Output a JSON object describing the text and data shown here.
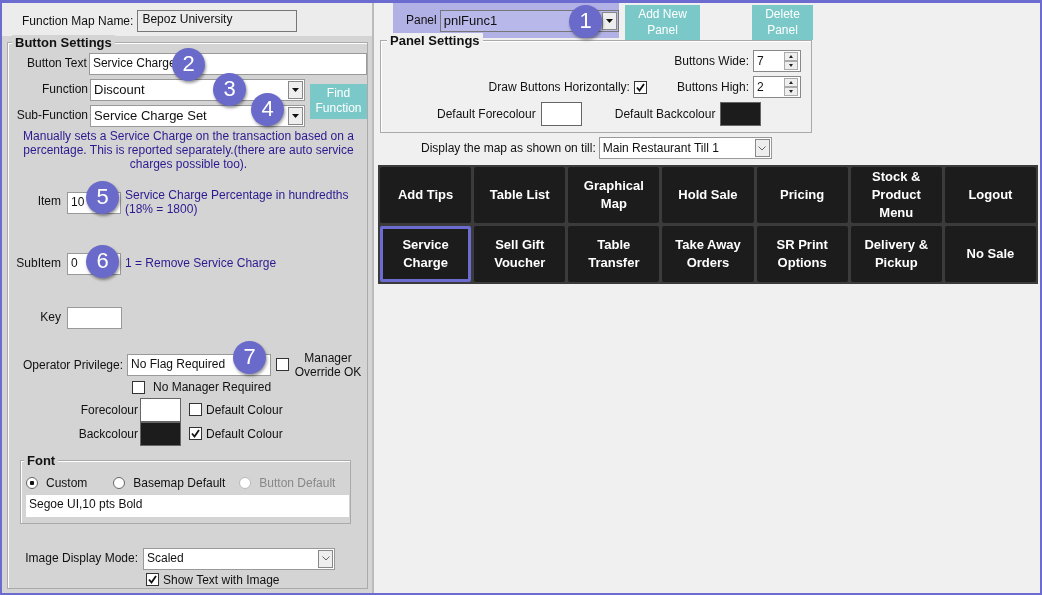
{
  "function_map": {
    "label": "Function Map Name:",
    "value": "Bepoz University"
  },
  "button_settings": {
    "title": "Button Settings",
    "button_text": {
      "label": "Button Text",
      "value": "Service Charge"
    },
    "function": {
      "label": "Function",
      "value": "Discount"
    },
    "sub_function": {
      "label": "Sub-Function",
      "value": "Service Charge Set"
    },
    "find_button": "Find Function",
    "description": "Manually sets a Service Charge on the transaction based on a percentage. This is reported separately.(there are auto service charges possible too).",
    "item": {
      "label": "Item",
      "value": "10",
      "hint": "Service Charge Percentage in hundredths (18% = 1800)"
    },
    "subitem": {
      "label": "SubItem",
      "value": "0",
      "hint": "1 = Remove Service Charge"
    },
    "key": {
      "label": "Key"
    },
    "operator_privilege": {
      "label": "Operator Privilege:",
      "value": "No Flag Required"
    },
    "manager_override": {
      "label": "Manager Override OK",
      "checked": false
    },
    "no_manager_required": {
      "label": "No Manager Required",
      "checked": false
    },
    "forecolour": {
      "label": "Forecolour",
      "color": "#ffffff",
      "default_label": "Default Colour",
      "default_checked": false
    },
    "backcolour": {
      "label": "Backcolour",
      "color": "#1c1c1c",
      "default_label": "Default Colour",
      "default_checked": true
    },
    "font": {
      "title": "Font",
      "options": [
        {
          "label": "Custom",
          "selected": true,
          "disabled": false
        },
        {
          "label": "Basemap Default",
          "selected": false,
          "disabled": false
        },
        {
          "label": "Button Default",
          "selected": false,
          "disabled": true
        }
      ],
      "value": "Segoe UI,10 pts Bold"
    },
    "image_display_mode": {
      "label": "Image Display Mode:",
      "value": "Scaled"
    },
    "show_text_with_image": {
      "label": "Show Text with Image",
      "checked": true
    }
  },
  "panel": {
    "label": "Panel",
    "value": "pnlFunc1"
  },
  "panel_buttons": [
    "Add New Panel",
    "Delete Panel"
  ],
  "panel_settings": {
    "title": "Panel Settings",
    "buttons_wide": {
      "label": "Buttons Wide:",
      "value": "7"
    },
    "draw_horizontally": {
      "label": "Draw Buttons Horizontally:",
      "checked": true
    },
    "buttons_high": {
      "label": "Buttons High:",
      "value": "2"
    },
    "default_forecolour": {
      "label": "Default Forecolour",
      "color": "#ffffff"
    },
    "default_backcolour": {
      "label": "Default Backcolour",
      "color": "#1c1c1c"
    }
  },
  "till_display": {
    "label": "Display the map as shown on till:",
    "value": "Main Restaurant Till 1"
  },
  "map_buttons": [
    {
      "label": "Add Tips",
      "selected": false
    },
    {
      "label": "Table List",
      "selected": false
    },
    {
      "label": "Graphical Map",
      "selected": false
    },
    {
      "label": "Hold Sale",
      "selected": false
    },
    {
      "label": "Pricing",
      "selected": false
    },
    {
      "label": "Stock & Product Menu",
      "selected": false
    },
    {
      "label": "Logout",
      "selected": false
    },
    {
      "label": "Service Charge",
      "selected": true
    },
    {
      "label": "Sell Gift Voucher",
      "selected": false
    },
    {
      "label": "Table Transfer",
      "selected": false
    },
    {
      "label": "Take Away Orders",
      "selected": false
    },
    {
      "label": "SR Print Options",
      "selected": false
    },
    {
      "label": "Delivery & Pickup",
      "selected": false
    },
    {
      "label": "No Sale",
      "selected": false
    }
  ],
  "callouts": [
    "1",
    "2",
    "3",
    "4",
    "5",
    "6",
    "7"
  ]
}
